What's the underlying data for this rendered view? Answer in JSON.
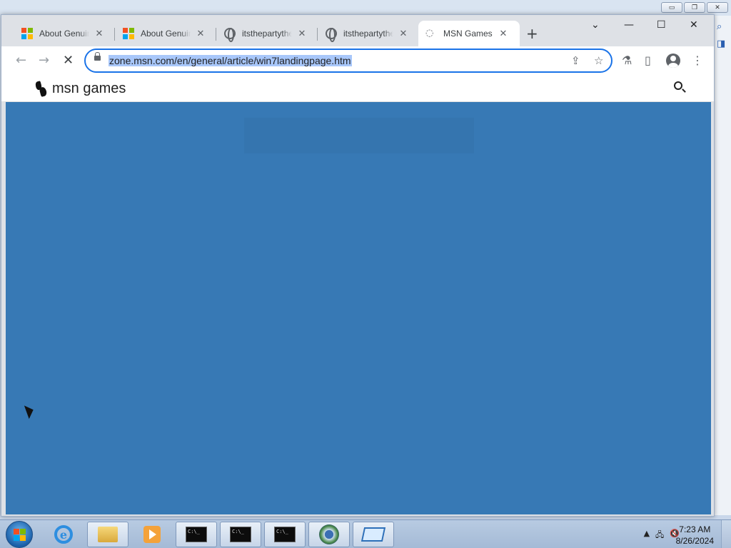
{
  "browser": {
    "tabs": [
      {
        "title": "About Genuine",
        "favicon": "microsoft-logo-icon",
        "close": "✕"
      },
      {
        "title": "About Genuine",
        "favicon": "microsoft-logo-icon",
        "close": "✕"
      },
      {
        "title": "itsthepartythere",
        "favicon": "globe-icon",
        "close": "✕"
      },
      {
        "title": "itsthepartythere",
        "favicon": "globe-icon",
        "close": "✕"
      },
      {
        "title": "MSN Games",
        "favicon": "loading-icon",
        "close": "✕"
      }
    ],
    "new_tab": "+",
    "window_controls": {
      "menu": "⌄",
      "minimize": "—",
      "maximize": "☐",
      "close": "✕"
    },
    "nav": {
      "back": "←",
      "forward": "→",
      "stop": "✕"
    },
    "address_bar": {
      "url": "zone.msn.com/en/general/article/win7landingpage.htm"
    },
    "toolbar_icons": {
      "share": "⇪",
      "bookmark": "☆",
      "labs": "⚗",
      "sidebar": "▯",
      "menu": "⋮"
    }
  },
  "page": {
    "brand": "msn games",
    "search_icon": "search-icon",
    "content_color": "#3779b5"
  },
  "taskbar": {
    "apps": [
      "internet-explorer",
      "file-explorer",
      "media-player",
      "cmd",
      "cmd",
      "cmd",
      "chrome",
      "remote-desktop"
    ],
    "cmd_label": "C:\\_",
    "tray": {
      "arrow": "▲",
      "network": "🖧",
      "volume": "🔇"
    },
    "clock": {
      "time": "7:23 AM",
      "date": "8/26/2024"
    }
  },
  "colors": {
    "accent": "#1a73e8",
    "url_highlight": "#a8c7fa"
  }
}
